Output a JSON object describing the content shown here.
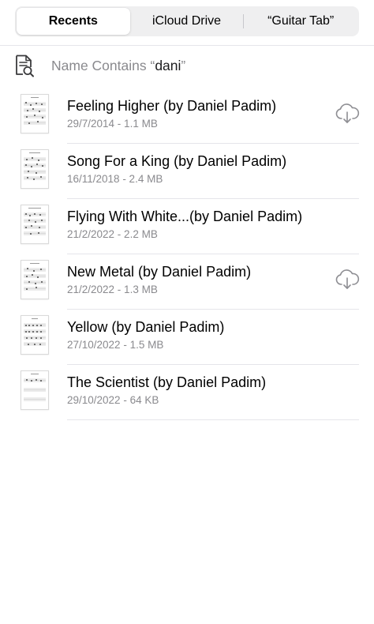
{
  "tabs": [
    {
      "label": "Recents",
      "selected": true
    },
    {
      "label": "iCloud Drive",
      "selected": false
    },
    {
      "label": "“Guitar Tab”",
      "selected": false
    }
  ],
  "search": {
    "prefix": "Name Contains “",
    "term": "dani",
    "suffix": "”",
    "icon": "document-search-icon"
  },
  "files": [
    {
      "title": "Feeling Higher (by Daniel Padim)",
      "meta": "29/7/2014 - 1.1 MB",
      "download_icon": true
    },
    {
      "title": "Song For a King (by Daniel Padim)",
      "meta": "16/11/2018 - 2.4 MB",
      "download_icon": false
    },
    {
      "title": "Flying With White...(by Daniel Padim)",
      "meta": "21/2/2022 - 2.2 MB",
      "download_icon": false
    },
    {
      "title": "New Metal (by Daniel Padim)",
      "meta": "21/2/2022 - 1.3 MB",
      "download_icon": true
    },
    {
      "title": "Yellow (by Daniel Padim)",
      "meta": "27/10/2022 - 1.5 MB",
      "download_icon": false
    },
    {
      "title": "The Scientist (by Daniel Padim)",
      "meta": "29/10/2022 - 64 KB",
      "download_icon": false
    }
  ],
  "colors": {
    "secondary_text": "#8a8a8e",
    "separator": "#e5e5ea",
    "segment_bg": "#efeff0",
    "icon_gray": "#8e8e93"
  }
}
